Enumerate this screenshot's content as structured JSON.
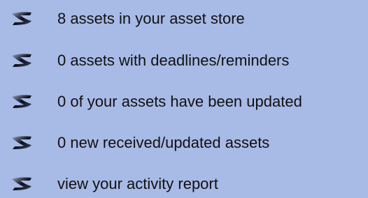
{
  "panel": {
    "background": "#A8BAE6",
    "text_color": "#111111",
    "icon": "z-swoosh-icon",
    "items": [
      {
        "label": "8 assets in your asset store"
      },
      {
        "label": "0 assets with deadlines/reminders"
      },
      {
        "label": "0 of your assets have been updated"
      },
      {
        "label": "0 new received/updated assets"
      },
      {
        "label": "view your activity report"
      }
    ]
  }
}
